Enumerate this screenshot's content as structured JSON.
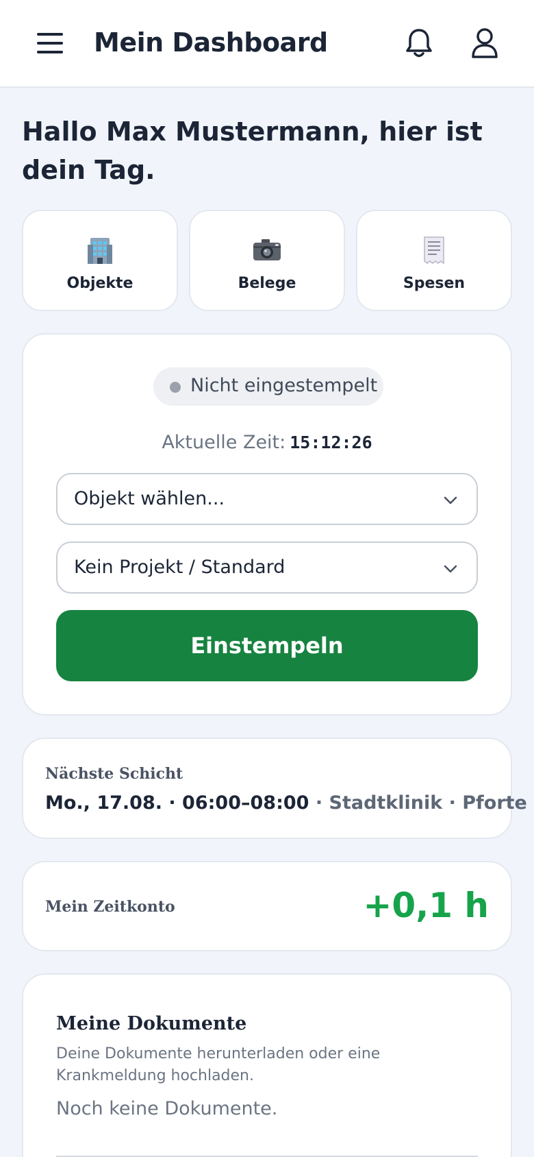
{
  "header": {
    "title": "Mein Dashboard",
    "menu_icon": "hamburger-menu-icon",
    "notifications_icon": "bell-icon",
    "profile_icon": "user-icon"
  },
  "greeting": "Hallo Max Mustermann, hier ist dein Tag.",
  "tiles": [
    {
      "label": "Objekte",
      "icon": "office-building-icon"
    },
    {
      "label": "Belege",
      "icon": "camera-icon"
    },
    {
      "label": "Spesen",
      "icon": "receipt-icon"
    }
  ],
  "clock": {
    "status": "Nicht eingestempelt",
    "status_color": "#9aa1ab",
    "time_label": "Aktuelle Zeit:",
    "time_value": "15:12:26",
    "object_select": "Objekt wählen...",
    "project_select": "Kein Projekt / Standard",
    "button": "Einstempeln",
    "button_color": "#178340"
  },
  "shift": {
    "title": "Nächste Schicht",
    "when": "Mo., 17.08. · 06:00–08:00",
    "where": " · Stadtklinik · Pforte"
  },
  "account": {
    "title": "Mein Zeitkonto",
    "value": "+0,1 h",
    "value_color": "#16a34a"
  },
  "documents": {
    "title": "Meine Dokumente",
    "description": "Deine Dokumente herunterladen oder eine Krankmeldung hochladen.",
    "empty": "Noch keine Dokumente."
  }
}
